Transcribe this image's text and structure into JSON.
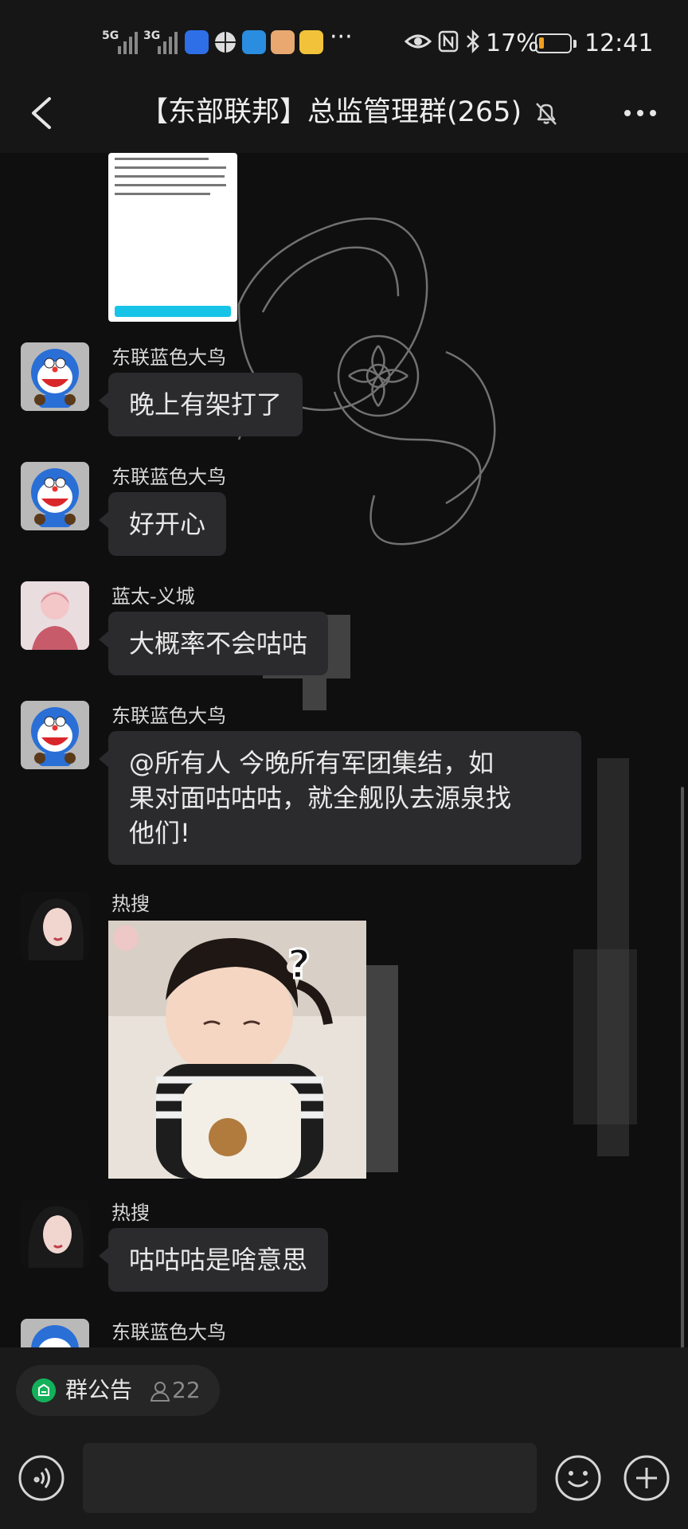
{
  "status_bar": {
    "network1": "5G",
    "network2": "3G",
    "battery_percent": "17%",
    "battery_level": 0.17,
    "time": "12:41",
    "dots": "···"
  },
  "header": {
    "title": "【东部联邦】总监管理群(265)"
  },
  "messages": [
    {
      "sender": "东联蓝色大鸟",
      "text": "晚上有架打了"
    },
    {
      "sender": "东联蓝色大鸟",
      "text": "好开心"
    },
    {
      "sender": "蓝太-义城",
      "text": "大概率不会咕咕"
    },
    {
      "sender": "东联蓝色大鸟",
      "text_line1": "@所有人  今晚所有军团集结，如",
      "text_line2": "果对面咕咕咕，就全舰队去源泉找",
      "text_line3": "他们!"
    },
    {
      "sender": "热搜",
      "image": "baby-photo"
    },
    {
      "sender": "热搜",
      "text": "咕咕咕是啥意思"
    },
    {
      "sender": "东联蓝色大鸟"
    }
  ],
  "notice": {
    "label": "群公告",
    "count": "22"
  },
  "colors": {
    "bubble": "#2b2b2d",
    "background": "#0f0f10",
    "notice_green": "#13b15a",
    "battery_orange": "#f0a020"
  },
  "icons": [
    "back-arrow-icon",
    "mute-bell-icon",
    "more-dots-icon",
    "voice-icon",
    "emoji-icon",
    "plus-icon"
  ]
}
